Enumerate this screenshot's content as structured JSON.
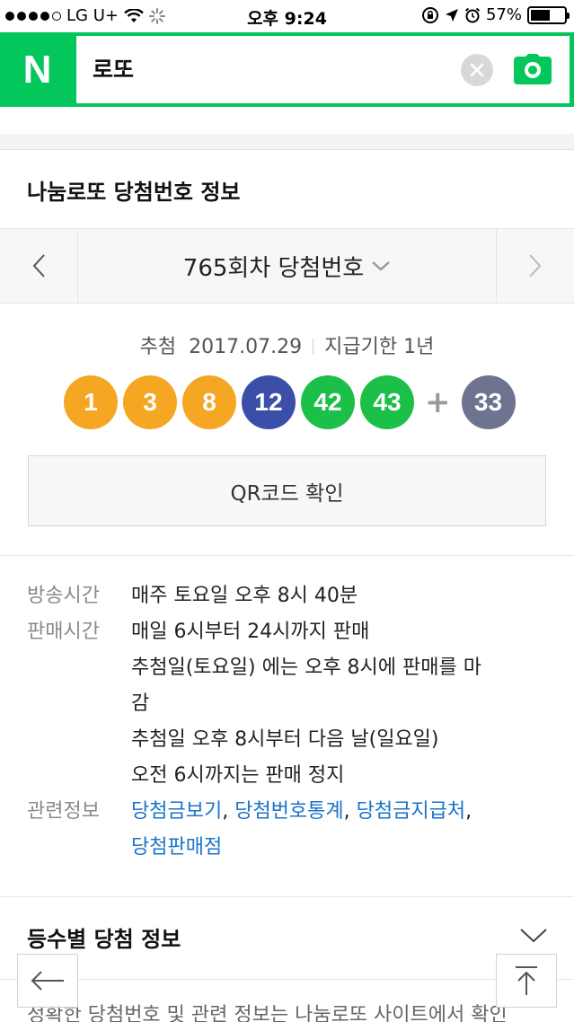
{
  "status_bar": {
    "carrier": "LG U+",
    "time": "오후 9:24",
    "battery": "57%",
    "battery_level": 0.57
  },
  "search": {
    "logo": "N",
    "query": "로또"
  },
  "card": {
    "title": "나눔로또 당첨번호 정보",
    "round_label": "765회차 당첨번호",
    "draw_prefix": "추첨",
    "draw_date": "2017.07.29",
    "payout_limit": "지급기한 1년",
    "numbers": [
      {
        "value": "1",
        "color": "#f5a623"
      },
      {
        "value": "3",
        "color": "#f5a623"
      },
      {
        "value": "8",
        "color": "#f5a623"
      },
      {
        "value": "12",
        "color": "#3b4fa8"
      },
      {
        "value": "42",
        "color": "#1cbf48"
      },
      {
        "value": "43",
        "color": "#1cbf48"
      }
    ],
    "plus": "+",
    "bonus": {
      "value": "33",
      "color": "#6e7490"
    },
    "qr_button": "QR코드 확인"
  },
  "info": {
    "broadcast_label": "방송시간",
    "broadcast_value": "매주 토요일 오후 8시 40분",
    "sales_label": "판매시간",
    "sales_lines": [
      "매일 6시부터 24시까지 판매",
      "추첨일(토요일) 에는 오후 8시에 판매를 마",
      "감",
      "추첨일 오후 8시부터 다음 날(일요일)",
      "오전 6시까지는 판매 정지"
    ],
    "related_label": "관련정보",
    "related_links": [
      "당첨금보기",
      "당첨번호통계",
      "당첨금지급처",
      "당첨판매점"
    ]
  },
  "rank_section": {
    "title": "등수별 당첨 정보",
    "notice": "정확한 당첨번호 및 관련 정보는 나눔로또 사이트에서 확인"
  },
  "colors": {
    "naver_green": "#03c75a",
    "link_blue": "#1a73c8"
  }
}
